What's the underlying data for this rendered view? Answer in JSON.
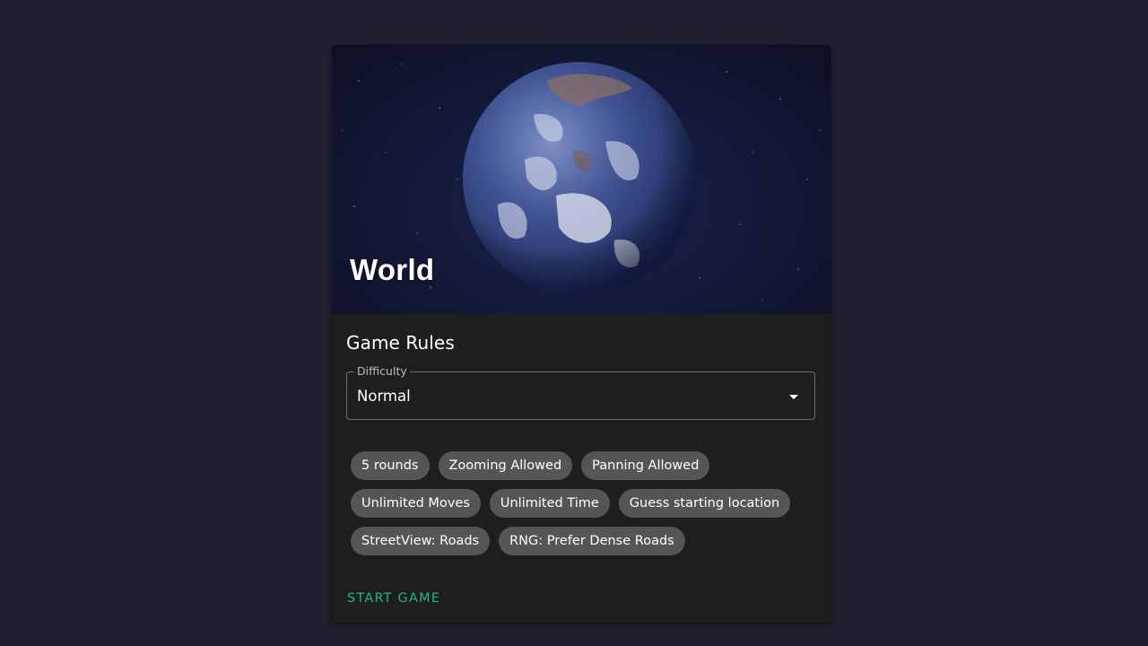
{
  "map": {
    "name": "World"
  },
  "rules": {
    "title": "Game Rules",
    "difficulty": {
      "label": "Difficulty",
      "value": "Normal"
    },
    "chips": [
      "5 rounds",
      "Zooming Allowed",
      "Panning Allowed",
      "Unlimited Moves",
      "Unlimited Time",
      "Guess starting location",
      "StreetView: Roads",
      "RNG: Prefer Dense Roads"
    ]
  },
  "actions": {
    "start_label": "START GAME"
  },
  "colors": {
    "page_background": "#221f2f",
    "card_background": "#1e1e1e",
    "chip_background": "#555555",
    "accent": "#1cb987"
  },
  "icons": {
    "select_arrow": "dropdown-arrow-icon",
    "hero_image": "earth-globe"
  }
}
